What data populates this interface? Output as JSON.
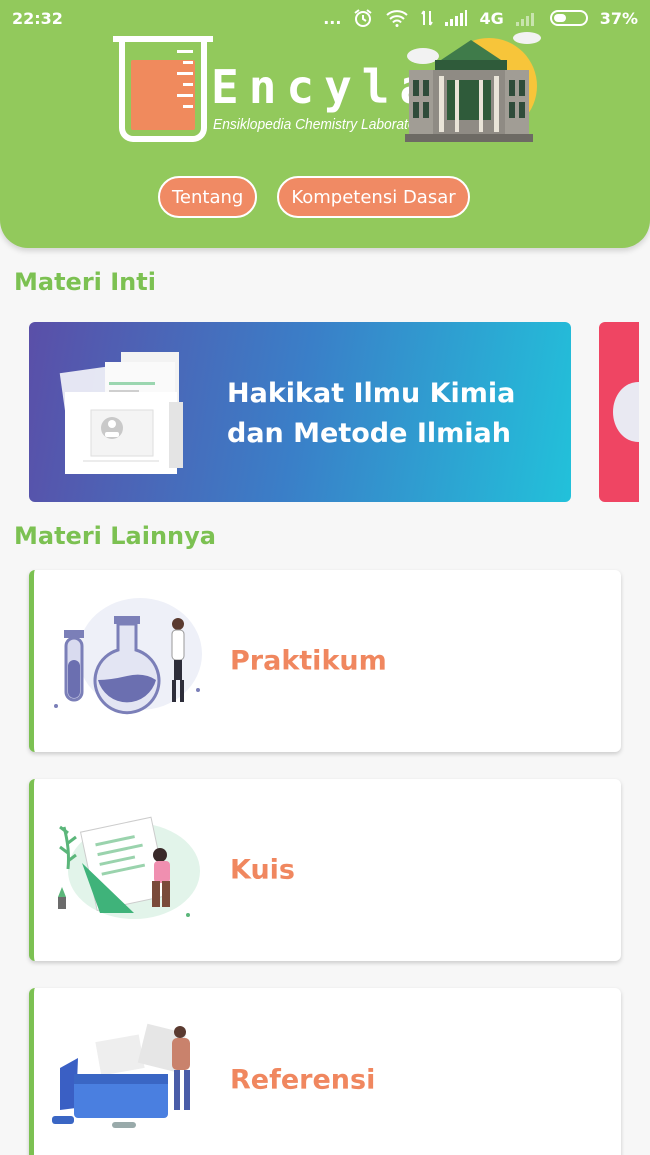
{
  "status_bar": {
    "time": "22:32",
    "dots": "...",
    "network": "4G",
    "battery": "37%"
  },
  "header": {
    "logo_title": "Encylab",
    "logo_subtitle": "Ensiklopedia Chemistry Laboratory",
    "buttons": [
      "Tentang",
      "Kompetensi Dasar"
    ]
  },
  "main_section": {
    "title": "Materi Inti",
    "cards": [
      {
        "title": "Hakikat Ilmu Kimia dan Metode Ilmiah"
      }
    ]
  },
  "other_section": {
    "title": "Materi Lainnya",
    "items": [
      {
        "label": "Praktikum",
        "icon": "lab-flask-illustration"
      },
      {
        "label": "Kuis",
        "icon": "quiz-document-illustration"
      },
      {
        "label": "Referensi",
        "icon": "reference-folder-illustration"
      }
    ]
  },
  "colors": {
    "header_green": "#92c95c",
    "accent_green": "#7cc152",
    "accent_orange": "#f0875f",
    "hero_gradient_start": "#5a4fa8",
    "hero_gradient_end": "#22c1da"
  }
}
